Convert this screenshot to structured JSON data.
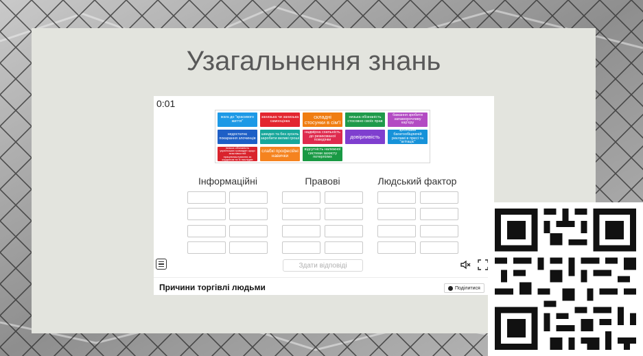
{
  "slide": {
    "title": "Узагальнення знань"
  },
  "activity": {
    "timer": "0:01",
    "tiles": [
      {
        "label": "жага до \"красивого життя\"",
        "color": "#1d99e6"
      },
      {
        "label": "занизька чи занизька самооцінка",
        "color": "#e3262f"
      },
      {
        "label": "складні стосунки в сім'ї",
        "color": "#f07d11"
      },
      {
        "label": "низька обізнаність стосовно своїх прав",
        "color": "#1f9a4a"
      },
      {
        "label": "бажання зробити запаморочливу кар'єру",
        "color": "#b34bc3"
      },
      {
        "label": "недостатнє покарання злочинців",
        "color": "#1e5fc6"
      },
      {
        "label": "швидко та без зусиль заробити великі гроші",
        "color": "#17a79b"
      },
      {
        "label": "надмірна схильність до ризикованої поведінки",
        "color": "#df2a4e"
      },
      {
        "label": "довірливість",
        "color": "#7f3fcf"
      },
      {
        "label": "зрібніший багатообіцяючій рекламі в пресі та \"агітаціє\"",
        "color": "#1692d9"
      },
      {
        "label": "низька обізнаність українських громадян щодо можливостей працевлаштування за кордоном та їх наслідків",
        "color": "#d9232d"
      },
      {
        "label": "слабкі професійні навички",
        "color": "#f5831f"
      },
      {
        "label": "відсутність належної системи захисту потерпілих",
        "color": "#199944"
      }
    ],
    "columns": [
      {
        "heading": "Інформаційні"
      },
      {
        "heading": "Правові"
      },
      {
        "heading": "Людський фактор"
      }
    ],
    "submit_label": "Здати відповіді",
    "footer_title": "Причини торгівлі людьми",
    "share_label": "Поділитися"
  }
}
